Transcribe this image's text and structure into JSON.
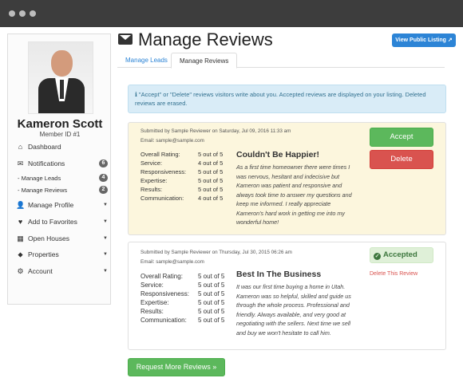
{
  "window": {
    "chrome": "mac-dark"
  },
  "sidebar": {
    "name": "Kameron Scott",
    "member_id": "Member ID #1",
    "items": [
      {
        "icon": "home-icon",
        "label": "Dashboard"
      },
      {
        "icon": "envelope-icon",
        "label": "Notifications",
        "badge": "6"
      },
      {
        "label": "- Manage Leads",
        "badge": "4"
      },
      {
        "label": "- Manage Reviews",
        "badge": "2"
      },
      {
        "icon": "user-icon",
        "label": "Manage Profile"
      },
      {
        "icon": "heart-icon",
        "label": "Add to Favorites"
      },
      {
        "icon": "calendar-icon",
        "label": "Open Houses"
      },
      {
        "icon": "tag-icon",
        "label": "Properties"
      },
      {
        "icon": "gear-icon",
        "label": "Account"
      }
    ]
  },
  "header": {
    "title": "Manage Reviews",
    "public_button": "View Public Listing ↗"
  },
  "tabs": [
    "Manage Leads",
    "Manage Reviews"
  ],
  "info": "ℹ \"Accept\" or \"Delete\" reviews visitors write about you. Accepted reviews are displayed on your listing. Deleted reviews are erased.",
  "reviews": [
    {
      "submitted": "Submitted by Sample Reviewer on Saturday, Jul 09, 2016 11:33 am",
      "email": "Email: sample@sample.com",
      "ratings": [
        {
          "label": "Overall Rating:",
          "value": "5 out of 5"
        },
        {
          "label": "Service:",
          "value": "4 out of 5"
        },
        {
          "label": "Responsiveness:",
          "value": "5 out of 5"
        },
        {
          "label": "Expertise:",
          "value": "5 out of 5"
        },
        {
          "label": "Results:",
          "value": "5 out of 5"
        },
        {
          "label": "Communication:",
          "value": "4 out of 5"
        }
      ],
      "title": "Couldn't Be Happier!",
      "body": "As a first time homeowner there were times I was nervous, hesitant and indecisive but Kameron was patient and responsive and always took time to answer my questions and keep me informed. I really appreciate Kameron's hard work in getting me into my wonderful home!",
      "accept_label": "Accept",
      "delete_label": "Delete"
    },
    {
      "submitted": "Submitted by Sample Reviewer on Thursday, Jul 30, 2015 06:26 am",
      "email": "Email: sample@sample.com",
      "ratings": [
        {
          "label": "Overall Rating:",
          "value": "5 out of 5"
        },
        {
          "label": "Service:",
          "value": "5 out of 5"
        },
        {
          "label": "Responsiveness:",
          "value": "5 out of 5"
        },
        {
          "label": "Expertise:",
          "value": "5 out of 5"
        },
        {
          "label": "Results:",
          "value": "5 out of 5"
        },
        {
          "label": "Communication:",
          "value": "5 out of 5"
        }
      ],
      "title": "Best In The Business",
      "body": "It was our first time buying a home in Utah. Kameron was so helpful, skilled and guide us through the whole process. Professional and friendly. Always available, and very good at negotiating with the sellers. Next time we sell and buy we won't hesitate to call him.",
      "accepted_label": "Accepted",
      "delete_link": "Delete This Review"
    }
  ],
  "request_button": "Request More Reviews »",
  "colors": {
    "primary": "#2c84d6",
    "success": "#5cb85c",
    "danger": "#d9534f",
    "pending_bg": "#fcf6dd"
  }
}
